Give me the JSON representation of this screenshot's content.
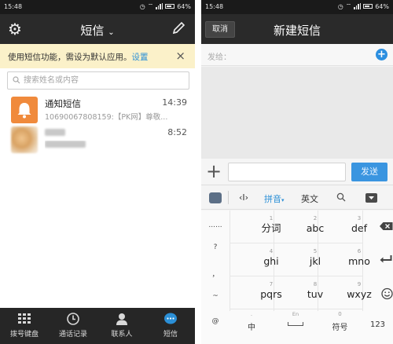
{
  "left": {
    "status": {
      "time": "15:48",
      "battery": "64%"
    },
    "header": {
      "title": "短信"
    },
    "notice": {
      "text": "使用短信功能，需设为默认应用。",
      "link": "设置",
      "close": "×"
    },
    "search": {
      "placeholder": "搜索姓名或内容"
    },
    "conversations": [
      {
        "name": "通知短信",
        "time": "14:39",
        "snippet": "10690067808159:【PK网】尊敬..."
      },
      {
        "time": "8:52"
      }
    ],
    "tabs": [
      {
        "label": "拨号键盘"
      },
      {
        "label": "通话记录"
      },
      {
        "label": "联系人"
      },
      {
        "label": "短信"
      }
    ],
    "colors": {
      "active_tab": "#2b8fd6",
      "notice_bg": "#fbf1c9",
      "accent": "#2b8fd6"
    }
  },
  "right": {
    "status": {
      "time": "15:48",
      "battery": "64%"
    },
    "header": {
      "title": "新建短信",
      "cancel": "取消"
    },
    "to_label": "发给：",
    "compose": {
      "send": "发送"
    },
    "toolbar": {
      "pinyin": "拼音",
      "english": "英文"
    },
    "keyboard": {
      "side_keys": [
        "......",
        "?",
        "，",
        "~",
        "@"
      ],
      "keys": [
        {
          "num": "1",
          "label": "分词"
        },
        {
          "num": "2",
          "label": "abc"
        },
        {
          "num": "3",
          "label": "def"
        },
        {
          "num": "4",
          "label": "ghi"
        },
        {
          "num": "5",
          "label": "jkl"
        },
        {
          "num": "6",
          "label": "mno"
        },
        {
          "num": "7",
          "label": "pqrs"
        },
        {
          "num": "8",
          "label": "tuv"
        },
        {
          "num": "9",
          "label": "wxyz"
        }
      ],
      "bottom": {
        "zh": "中",
        "en_hint": "En",
        "zero": "0",
        "symbol": "符号",
        "num": "123"
      }
    }
  }
}
